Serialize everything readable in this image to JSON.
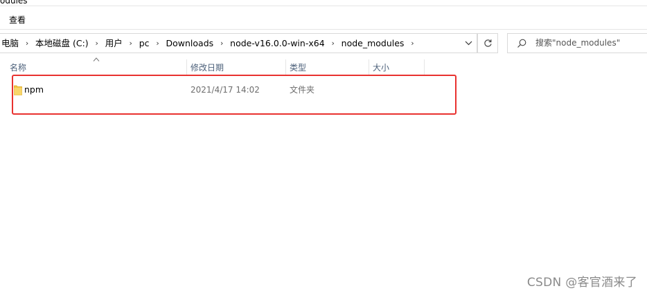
{
  "window": {
    "title_fragment": "odules"
  },
  "ribbon": {
    "tab_view": "查看"
  },
  "address": {
    "crumbs": [
      "电脑",
      "本地磁盘 (C:)",
      "用户",
      "pc",
      "Downloads",
      "node-v16.0.0-win-x64",
      "node_modules"
    ]
  },
  "search": {
    "placeholder": "搜索\"node_modules\""
  },
  "columns": {
    "name": "名称",
    "modified": "修改日期",
    "type": "类型",
    "size": "大小"
  },
  "files": [
    {
      "name": "npm",
      "modified": "2021/4/17 14:02",
      "type": "文件夹",
      "size": ""
    }
  ],
  "annotation": {
    "color": "#e8312f"
  },
  "colors": {
    "header_text": "#4c607a",
    "folder": "#f4c542"
  },
  "watermark": "CSDN @客官酒来了"
}
